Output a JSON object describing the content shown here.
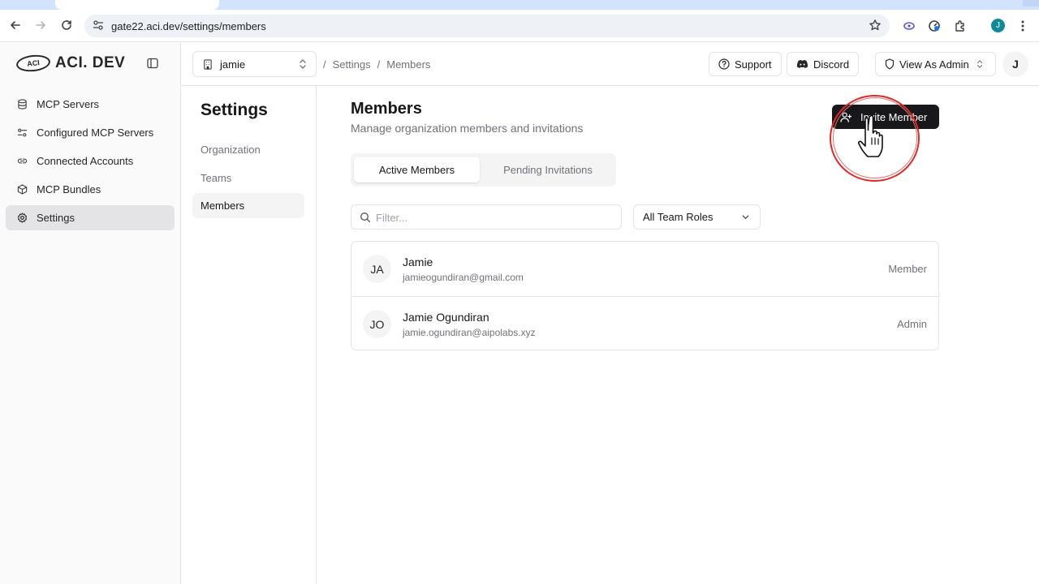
{
  "browser": {
    "url": "gate22.aci.dev/settings/members",
    "profile_initial": "J"
  },
  "sidebar": {
    "logo_mark": "ACI",
    "brand": "ACI. DEV",
    "items": [
      {
        "label": "MCP Servers",
        "icon": "database-icon"
      },
      {
        "label": "Configured MCP Servers",
        "icon": "sliders-icon"
      },
      {
        "label": "Connected Accounts",
        "icon": "link-icon"
      },
      {
        "label": "MCP Bundles",
        "icon": "package-icon"
      },
      {
        "label": "Settings",
        "icon": "gear-icon",
        "active": true
      }
    ]
  },
  "topbar": {
    "org": "jamie",
    "breadcrumb": [
      "Settings",
      "Members"
    ],
    "support_label": "Support",
    "discord_label": "Discord",
    "view_as_label": "View As Admin",
    "avatar_initial": "J"
  },
  "settings_nav": {
    "title": "Settings",
    "items": [
      {
        "label": "Organization"
      },
      {
        "label": "Teams"
      },
      {
        "label": "Members",
        "active": true
      }
    ]
  },
  "members": {
    "title": "Members",
    "subtitle": "Manage organization members and invitations",
    "invite_label": "Invite Member",
    "tabs": [
      {
        "label": "Active Members",
        "active": true
      },
      {
        "label": "Pending Invitations"
      }
    ],
    "filter_placeholder": "Filter...",
    "role_filter": "All Team Roles",
    "list": [
      {
        "initials": "JA",
        "name": "Jamie",
        "email": "jamieogundiran@gmail.com",
        "role": "Member"
      },
      {
        "initials": "JO",
        "name": "Jamie Ogundiran",
        "email": "jamie.ogundiran@aipolabs.xyz",
        "role": "Admin"
      }
    ]
  },
  "colors": {
    "accent_dark": "#18181b",
    "highlight_ring": "#d92b2b",
    "profile_teal": "#0f8a95"
  }
}
